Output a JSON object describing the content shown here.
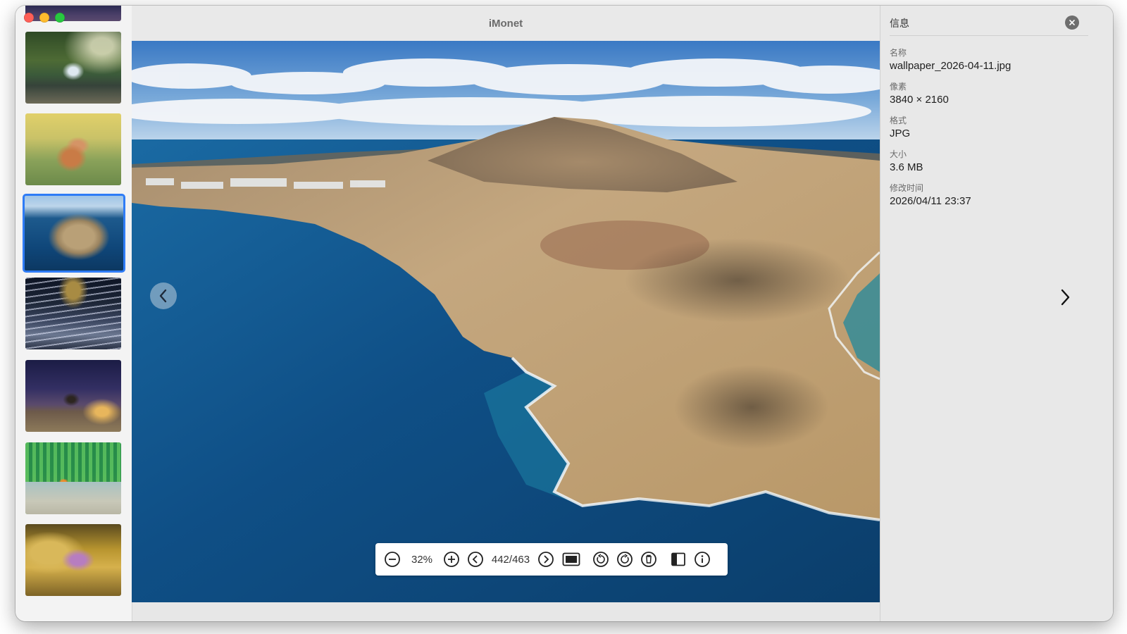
{
  "window": {
    "title": "iMonet"
  },
  "sidebar": {
    "thumbnails": [
      {
        "name": "waterfall"
      },
      {
        "name": "fox"
      },
      {
        "name": "coastline",
        "selected": true
      },
      {
        "name": "highway-night"
      },
      {
        "name": "milky-way-tree"
      },
      {
        "name": "coral-clownfish"
      },
      {
        "name": "golden-cave"
      }
    ]
  },
  "toolbar": {
    "zoom": "32%",
    "counter": "442/463",
    "icons": [
      "zoom-out-icon",
      "zoom-in-icon",
      "previous-icon",
      "next-icon",
      "fit-screen-icon",
      "rotate-left-icon",
      "rotate-right-icon",
      "delete-icon",
      "sidebar-toggle-icon",
      "info-icon"
    ]
  },
  "info": {
    "title": "信息",
    "fields": {
      "name_label": "名称",
      "name_value": "wallpaper_2026-04-11.jpg",
      "pixels_label": "像素",
      "pixels_value": "3840 × 2160",
      "format_label": "格式",
      "format_value": "JPG",
      "size_label": "大小",
      "size_value": "3.6 MB",
      "modified_label": "修改时间",
      "modified_value": "2026/04/11 23:37"
    }
  },
  "colors": {
    "selection": "#2f7cf6",
    "close_red": "#fe5f57",
    "minimize_yellow": "#febc2e",
    "zoom_green": "#28c840"
  }
}
